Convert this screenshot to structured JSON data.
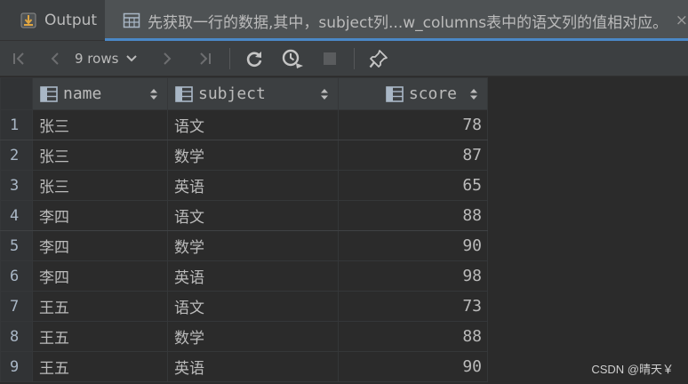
{
  "tabs": {
    "output_label": "Output",
    "result_title": "先获取一行的数据,其中，subject列...w_columns表中的语文列的值相对应。",
    "close_glyph": "×"
  },
  "toolbar": {
    "rows_label": "9 rows"
  },
  "table": {
    "columns": [
      {
        "label": "name"
      },
      {
        "label": "subject"
      },
      {
        "label": "score"
      }
    ],
    "rows": [
      {
        "num": "1",
        "name": "张三",
        "subject": "语文",
        "score": "78"
      },
      {
        "num": "2",
        "name": "张三",
        "subject": "数学",
        "score": "87"
      },
      {
        "num": "3",
        "name": "张三",
        "subject": "英语",
        "score": "65"
      },
      {
        "num": "4",
        "name": "李四",
        "subject": "语文",
        "score": "88"
      },
      {
        "num": "5",
        "name": "李四",
        "subject": "数学",
        "score": "90"
      },
      {
        "num": "6",
        "name": "李四",
        "subject": "英语",
        "score": "98"
      },
      {
        "num": "7",
        "name": "王五",
        "subject": "语文",
        "score": "73"
      },
      {
        "num": "8",
        "name": "王五",
        "subject": "数学",
        "score": "88"
      },
      {
        "num": "9",
        "name": "王五",
        "subject": "英语",
        "score": "90"
      }
    ]
  },
  "watermark": "CSDN @晴天￥",
  "icons": {
    "output": "output-icon",
    "table": "table-icon",
    "first": "first-page-icon",
    "prev": "previous-page-icon",
    "next": "next-page-icon",
    "last": "last-page-icon",
    "refresh": "refresh-icon",
    "history": "history-icon",
    "stop": "stop-icon",
    "pin": "pin-icon",
    "sort": "sort-icon",
    "column": "column-icon"
  },
  "colors": {
    "background": "#2b2b2b",
    "panel": "#3c3f41",
    "active_tab": "#4e5254",
    "accent": "#4a88c7",
    "text": "#bbbbbb",
    "output_icon": "#e0a642"
  }
}
